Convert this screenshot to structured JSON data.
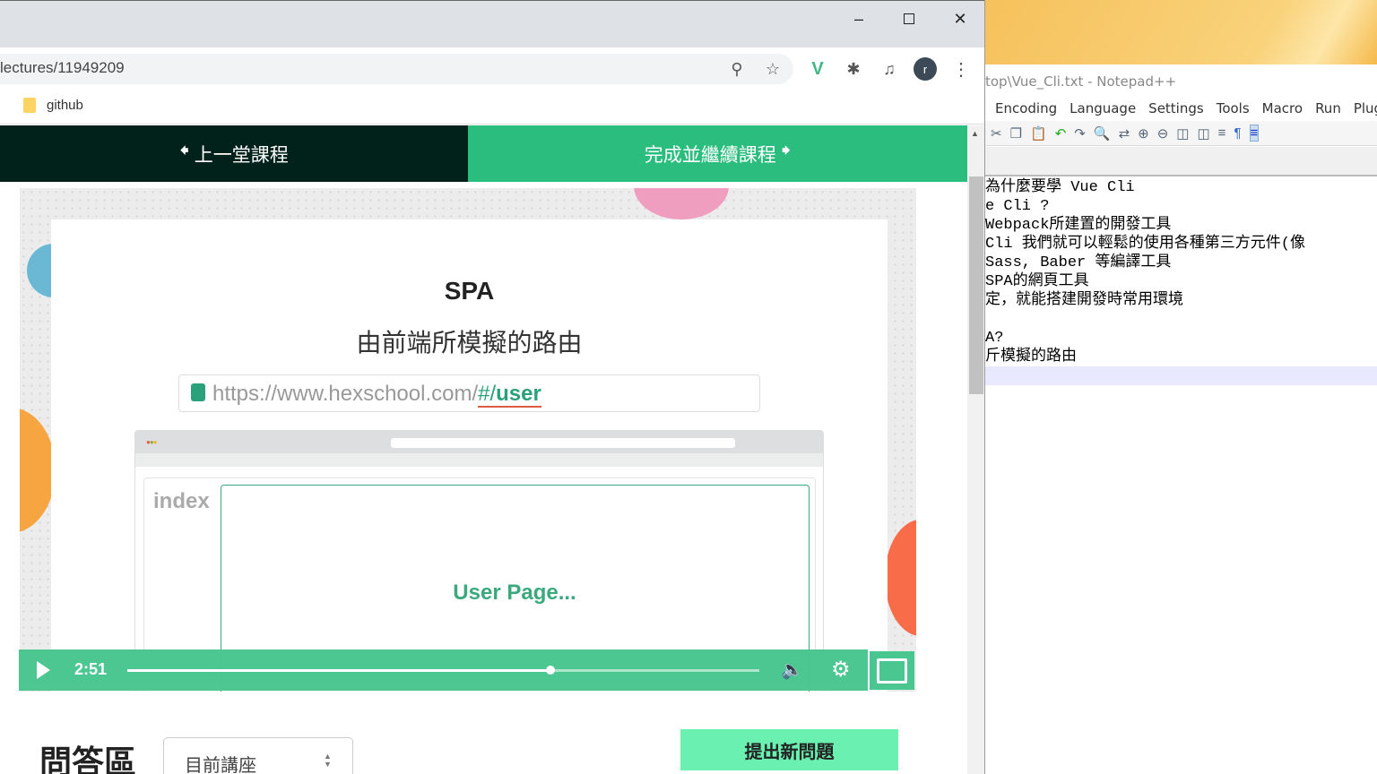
{
  "browser": {
    "url": "lectures/11949209",
    "bookmark": "github",
    "avatar_letter": "r"
  },
  "nav": {
    "prev_label": "上一堂課程",
    "next_label": "完成並繼續課程"
  },
  "slide": {
    "title": "SPA",
    "subtitle": "由前端所模擬的路由",
    "url_prefix": "https://www.hexschool.com/",
    "url_hash": "#/",
    "url_path": "user",
    "sidebar_label": "index",
    "page_text": "User Page..."
  },
  "player": {
    "time": "2:51",
    "progress": 0.67
  },
  "qa": {
    "title": "問答區",
    "filter": "目前講座",
    "new_question": "提出新問題"
  },
  "notepad": {
    "title": "top\\Vue_Cli.txt - Notepad++",
    "menu": [
      "Encoding",
      "Language",
      "Settings",
      "Tools",
      "Macro",
      "Run",
      "Plugi"
    ],
    "lines": [
      "為什麼要學 Vue Cli",
      "e Cli ?",
      "Webpack所建置的開發工具",
      "Cli 我們就可以輕鬆的使用各種第三方元件(像",
      "Sass, Baber 等編譯工具",
      "SPA的網頁工具",
      "定，就能搭建開發時常用環境",
      "",
      "A?",
      "斤模擬的路由",
      ""
    ]
  },
  "colors": {
    "dark_green": "#00221a",
    "green": "#2bbd7e",
    "player": "#4ac690",
    "qa_button": "#6af0b0"
  }
}
